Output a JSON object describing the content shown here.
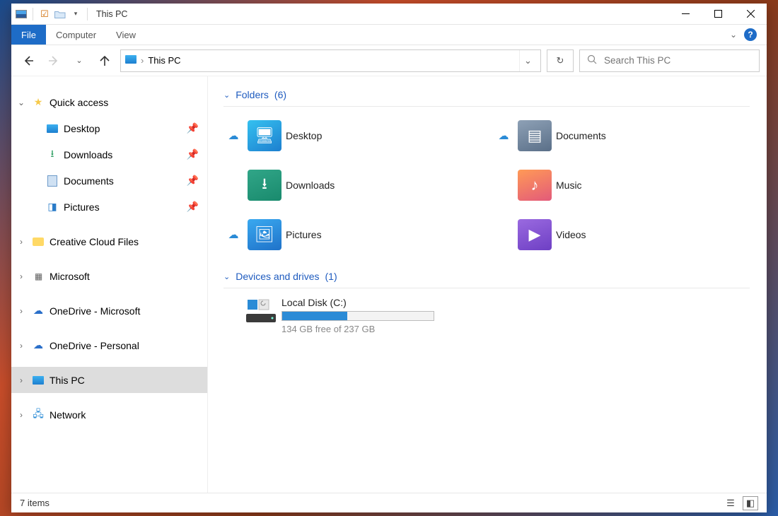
{
  "window": {
    "title": "This PC"
  },
  "ribbon": {
    "tabs": {
      "file": "File",
      "computer": "Computer",
      "view": "View"
    }
  },
  "nav": {
    "breadcrumb": "This PC",
    "search_placeholder": "Search This PC"
  },
  "sidebar": {
    "quick_access": {
      "label": "Quick access"
    },
    "quick_items": [
      {
        "label": "Desktop",
        "pinned": true
      },
      {
        "label": "Downloads",
        "pinned": true
      },
      {
        "label": "Documents",
        "pinned": true
      },
      {
        "label": "Pictures",
        "pinned": true
      }
    ],
    "creative": "Creative Cloud Files",
    "microsoft": "Microsoft",
    "onedrive_ms": "OneDrive - Microsoft",
    "onedrive_personal": "OneDrive - Personal",
    "this_pc": "This PC",
    "network": "Network"
  },
  "groups": {
    "folders": {
      "label": "Folders",
      "count": "(6)"
    },
    "devices": {
      "label": "Devices and drives",
      "count": "(1)"
    }
  },
  "folders": {
    "desktop": "Desktop",
    "documents": "Documents",
    "downloads": "Downloads",
    "music": "Music",
    "pictures": "Pictures",
    "videos": "Videos"
  },
  "drive": {
    "name": "Local Disk (C:)",
    "free_text": "134 GB free of 237 GB",
    "fill_percent": 43
  },
  "status": {
    "items": "7 items"
  }
}
